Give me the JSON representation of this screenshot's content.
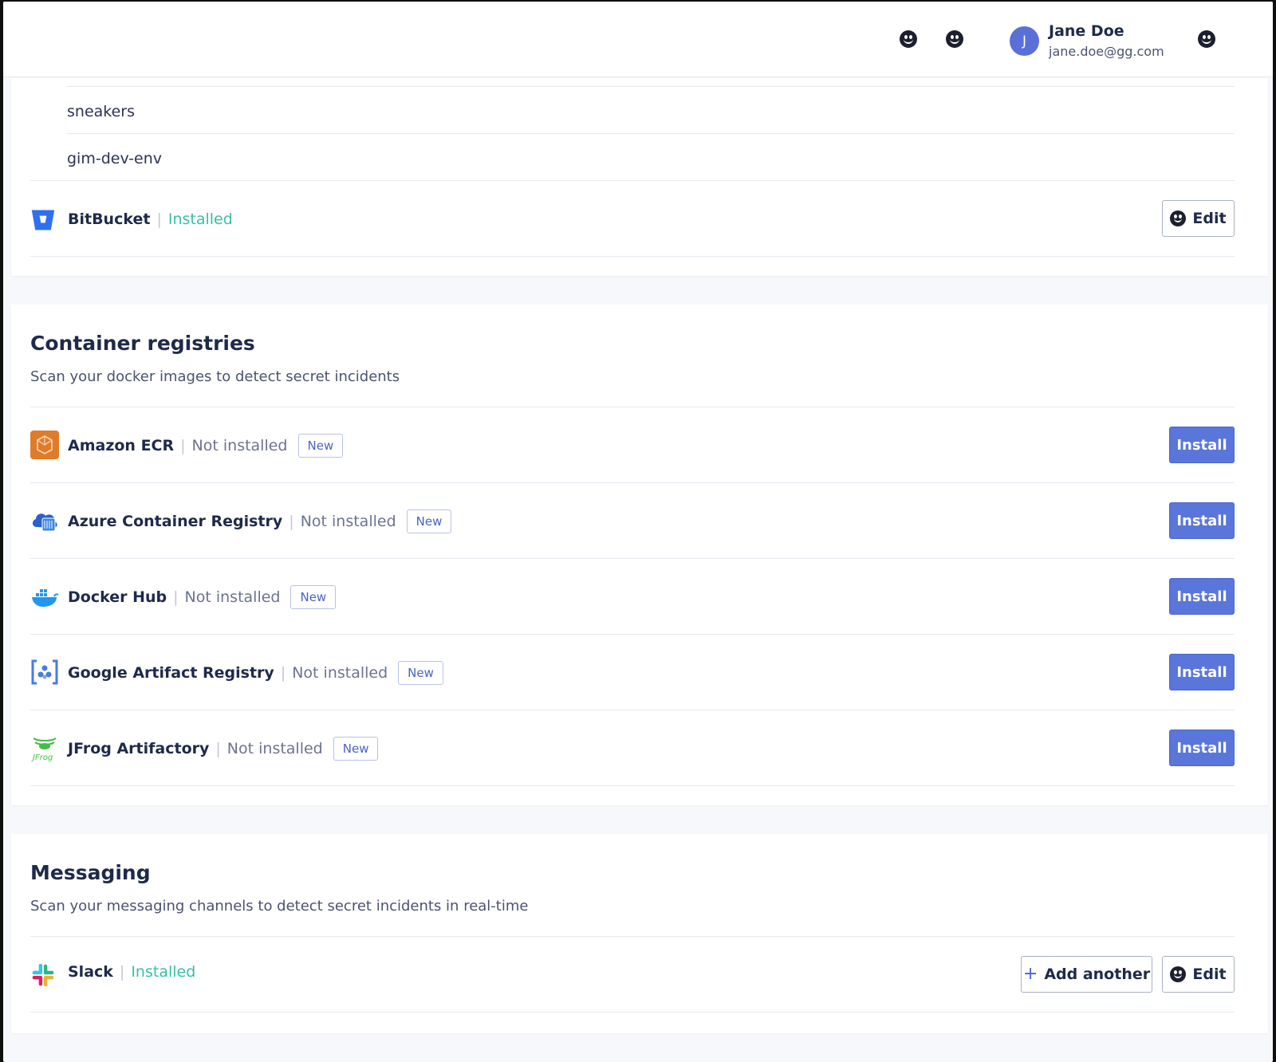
{
  "header": {
    "user": {
      "initial": "J",
      "name": "Jane Doe",
      "email": "jane.doe@gg.com"
    },
    "icons": [
      "smiley-icon",
      "smiley-icon",
      "smiley-icon"
    ]
  },
  "vcs": {
    "repos": [
      "sneakers",
      "gim-dev-env"
    ],
    "bitbucket": {
      "name": "BitBucket",
      "status": "Installed",
      "edit_label": "Edit"
    }
  },
  "container": {
    "title": "Container registries",
    "description": "Scan your docker images to detect secret incidents",
    "items": [
      {
        "name": "Amazon ECR",
        "status": "Not installed",
        "badge": "New",
        "action": "Install",
        "icon": "amazon-ecr-icon"
      },
      {
        "name": "Azure Container Registry",
        "status": "Not installed",
        "badge": "New",
        "action": "Install",
        "icon": "azure-cloud-icon"
      },
      {
        "name": "Docker Hub",
        "status": "Not installed",
        "badge": "New",
        "action": "Install",
        "icon": "docker-whale-icon"
      },
      {
        "name": "Google Artifact Registry",
        "status": "Not installed",
        "badge": "New",
        "action": "Install",
        "icon": "google-artifact-icon"
      },
      {
        "name": "JFrog Artifactory",
        "status": "Not installed",
        "badge": "New",
        "action": "Install",
        "icon": "jfrog-icon"
      }
    ]
  },
  "messaging": {
    "title": "Messaging",
    "description": "Scan your messaging channels to detect secret incidents in real-time",
    "slack": {
      "name": "Slack",
      "status": "Installed",
      "add_label": "Add another",
      "edit_label": "Edit"
    }
  },
  "colors": {
    "accent": "#5a76da",
    "installed": "#37c0a6"
  }
}
